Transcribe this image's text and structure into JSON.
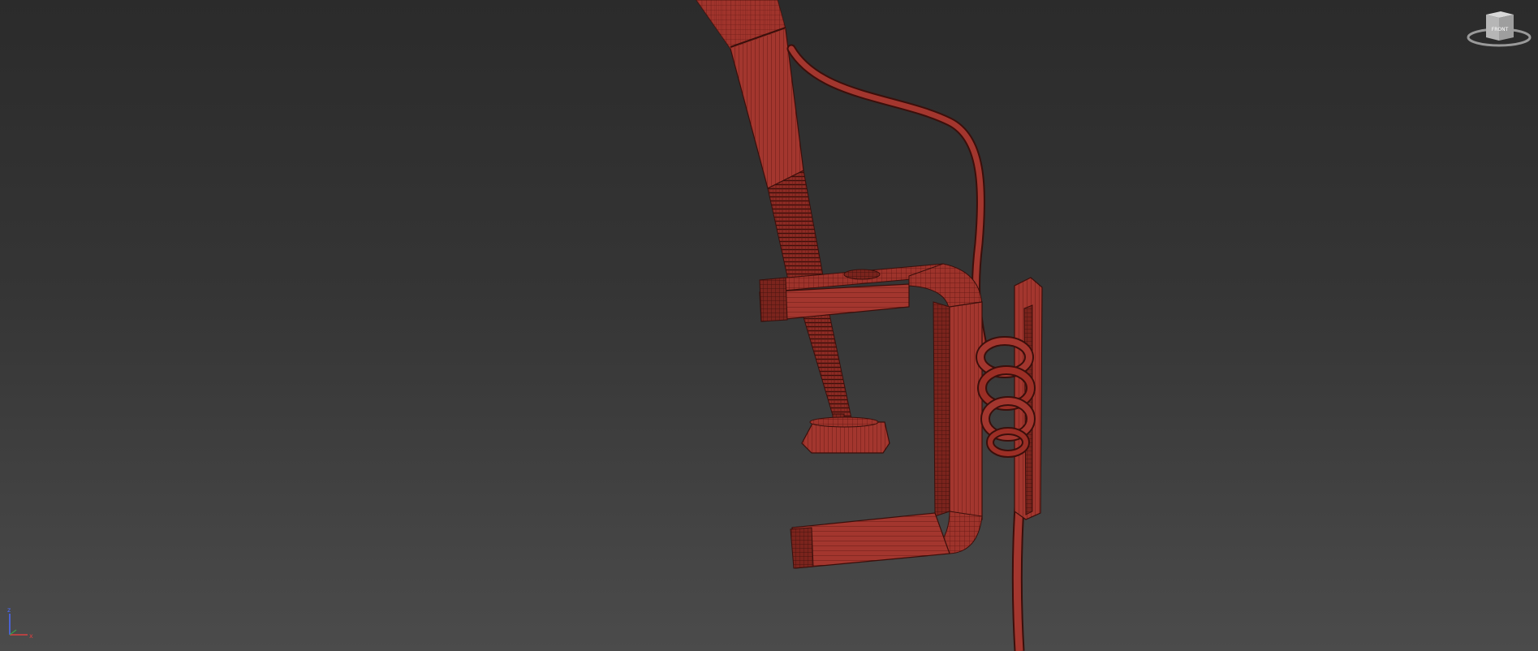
{
  "viewport": {
    "background_top": "#2b2b2b",
    "background_bottom": "#4b4b4b"
  },
  "model": {
    "wire_color": "#9b2e25",
    "fill_color": "#a3362e",
    "shade_color": "#6a1f19",
    "edge_color": "#3a0f0b"
  },
  "viewcube": {
    "face_label": "FRONT",
    "icon": "viewcube-icon"
  },
  "axis_gizmo": {
    "z_label": "z",
    "x_label": "x",
    "colors": {
      "x": "#d84040",
      "z": "#4a6bff"
    }
  }
}
